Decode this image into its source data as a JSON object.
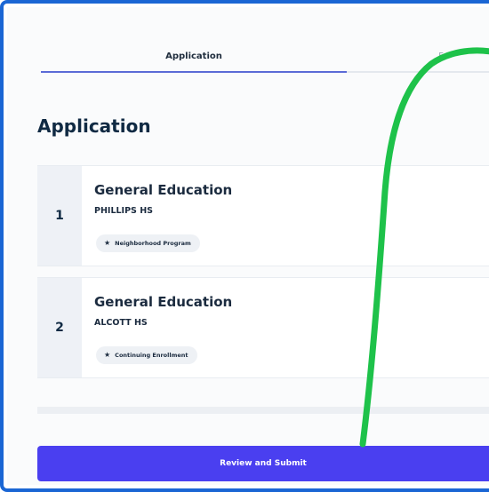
{
  "tabs": {
    "application": "Application",
    "second": "F"
  },
  "page_title": "Application",
  "choices": [
    {
      "rank": "1",
      "program": "General Education",
      "school": "PHILLIPS HS",
      "badge": "Neighborhood Program"
    },
    {
      "rank": "2",
      "program": "General Education",
      "school": "ALCOTT HS",
      "badge": "Continuing Enrollment"
    }
  ],
  "submit_label": "Review and Submit",
  "colors": {
    "frame_border": "#1a66d4",
    "submit_bg": "#4a3ff0",
    "annotation_stroke": "#1ec24a",
    "tab_underline": "#5b6bd6"
  },
  "icons": {
    "badge": "star-icon"
  }
}
